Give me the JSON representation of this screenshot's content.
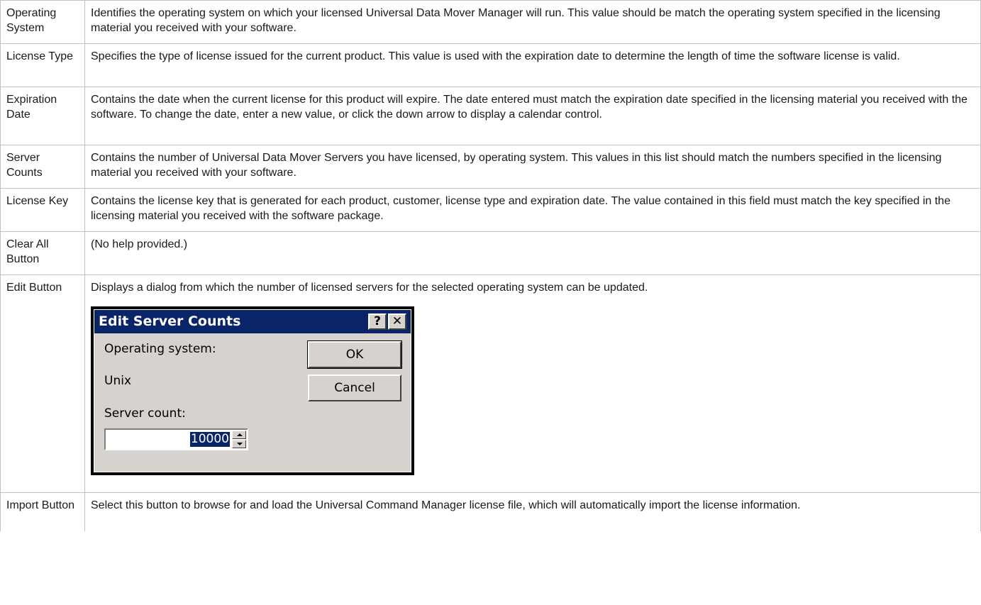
{
  "rows": [
    {
      "term": "Operating System",
      "description": "Identifies the operating system on which your licensed Universal Data Mover Manager will run. This value should be match the operating system specified in the licensing material you received with your software."
    },
    {
      "term": "License Type",
      "description": "Specifies the type of license issued for the current product. This value is used with the expiration date to determine the length of time the software license is valid."
    },
    {
      "term": "Expiration Date",
      "description": "Contains the date when the current license for this product will expire. The date entered must match the expiration date specified in the licensing material you received with the software. To change the date, enter a new value, or click the down arrow to display a calendar control."
    },
    {
      "term": "Server Counts",
      "description": "Contains the number of Universal Data Mover Servers you have licensed, by operating system. This values in this list should match the numbers specified in the licensing material you received with your software."
    },
    {
      "term": "License Key",
      "description": "Contains the license key that is generated for each product, customer, license type and expiration date. The value contained in this field must match the key specified in the licensing material you received with the software package."
    },
    {
      "term": "Clear All Button",
      "description": "(No help provided.)"
    },
    {
      "term": "Edit Button",
      "description": "Displays a dialog from which the number of licensed servers for the selected operating system can be updated."
    },
    {
      "term": "Import Button",
      "description": "Select this button to browse for and load the Universal Command Manager license file, which will automatically import the license information."
    }
  ],
  "dialog": {
    "title": "Edit Server Counts",
    "help_glyph": "?",
    "close_glyph": "✕",
    "os_label": "Operating system:",
    "os_value": "Unix",
    "count_label": "Server count:",
    "count_value": "10000",
    "ok_label": "OK",
    "cancel_label": "Cancel"
  }
}
